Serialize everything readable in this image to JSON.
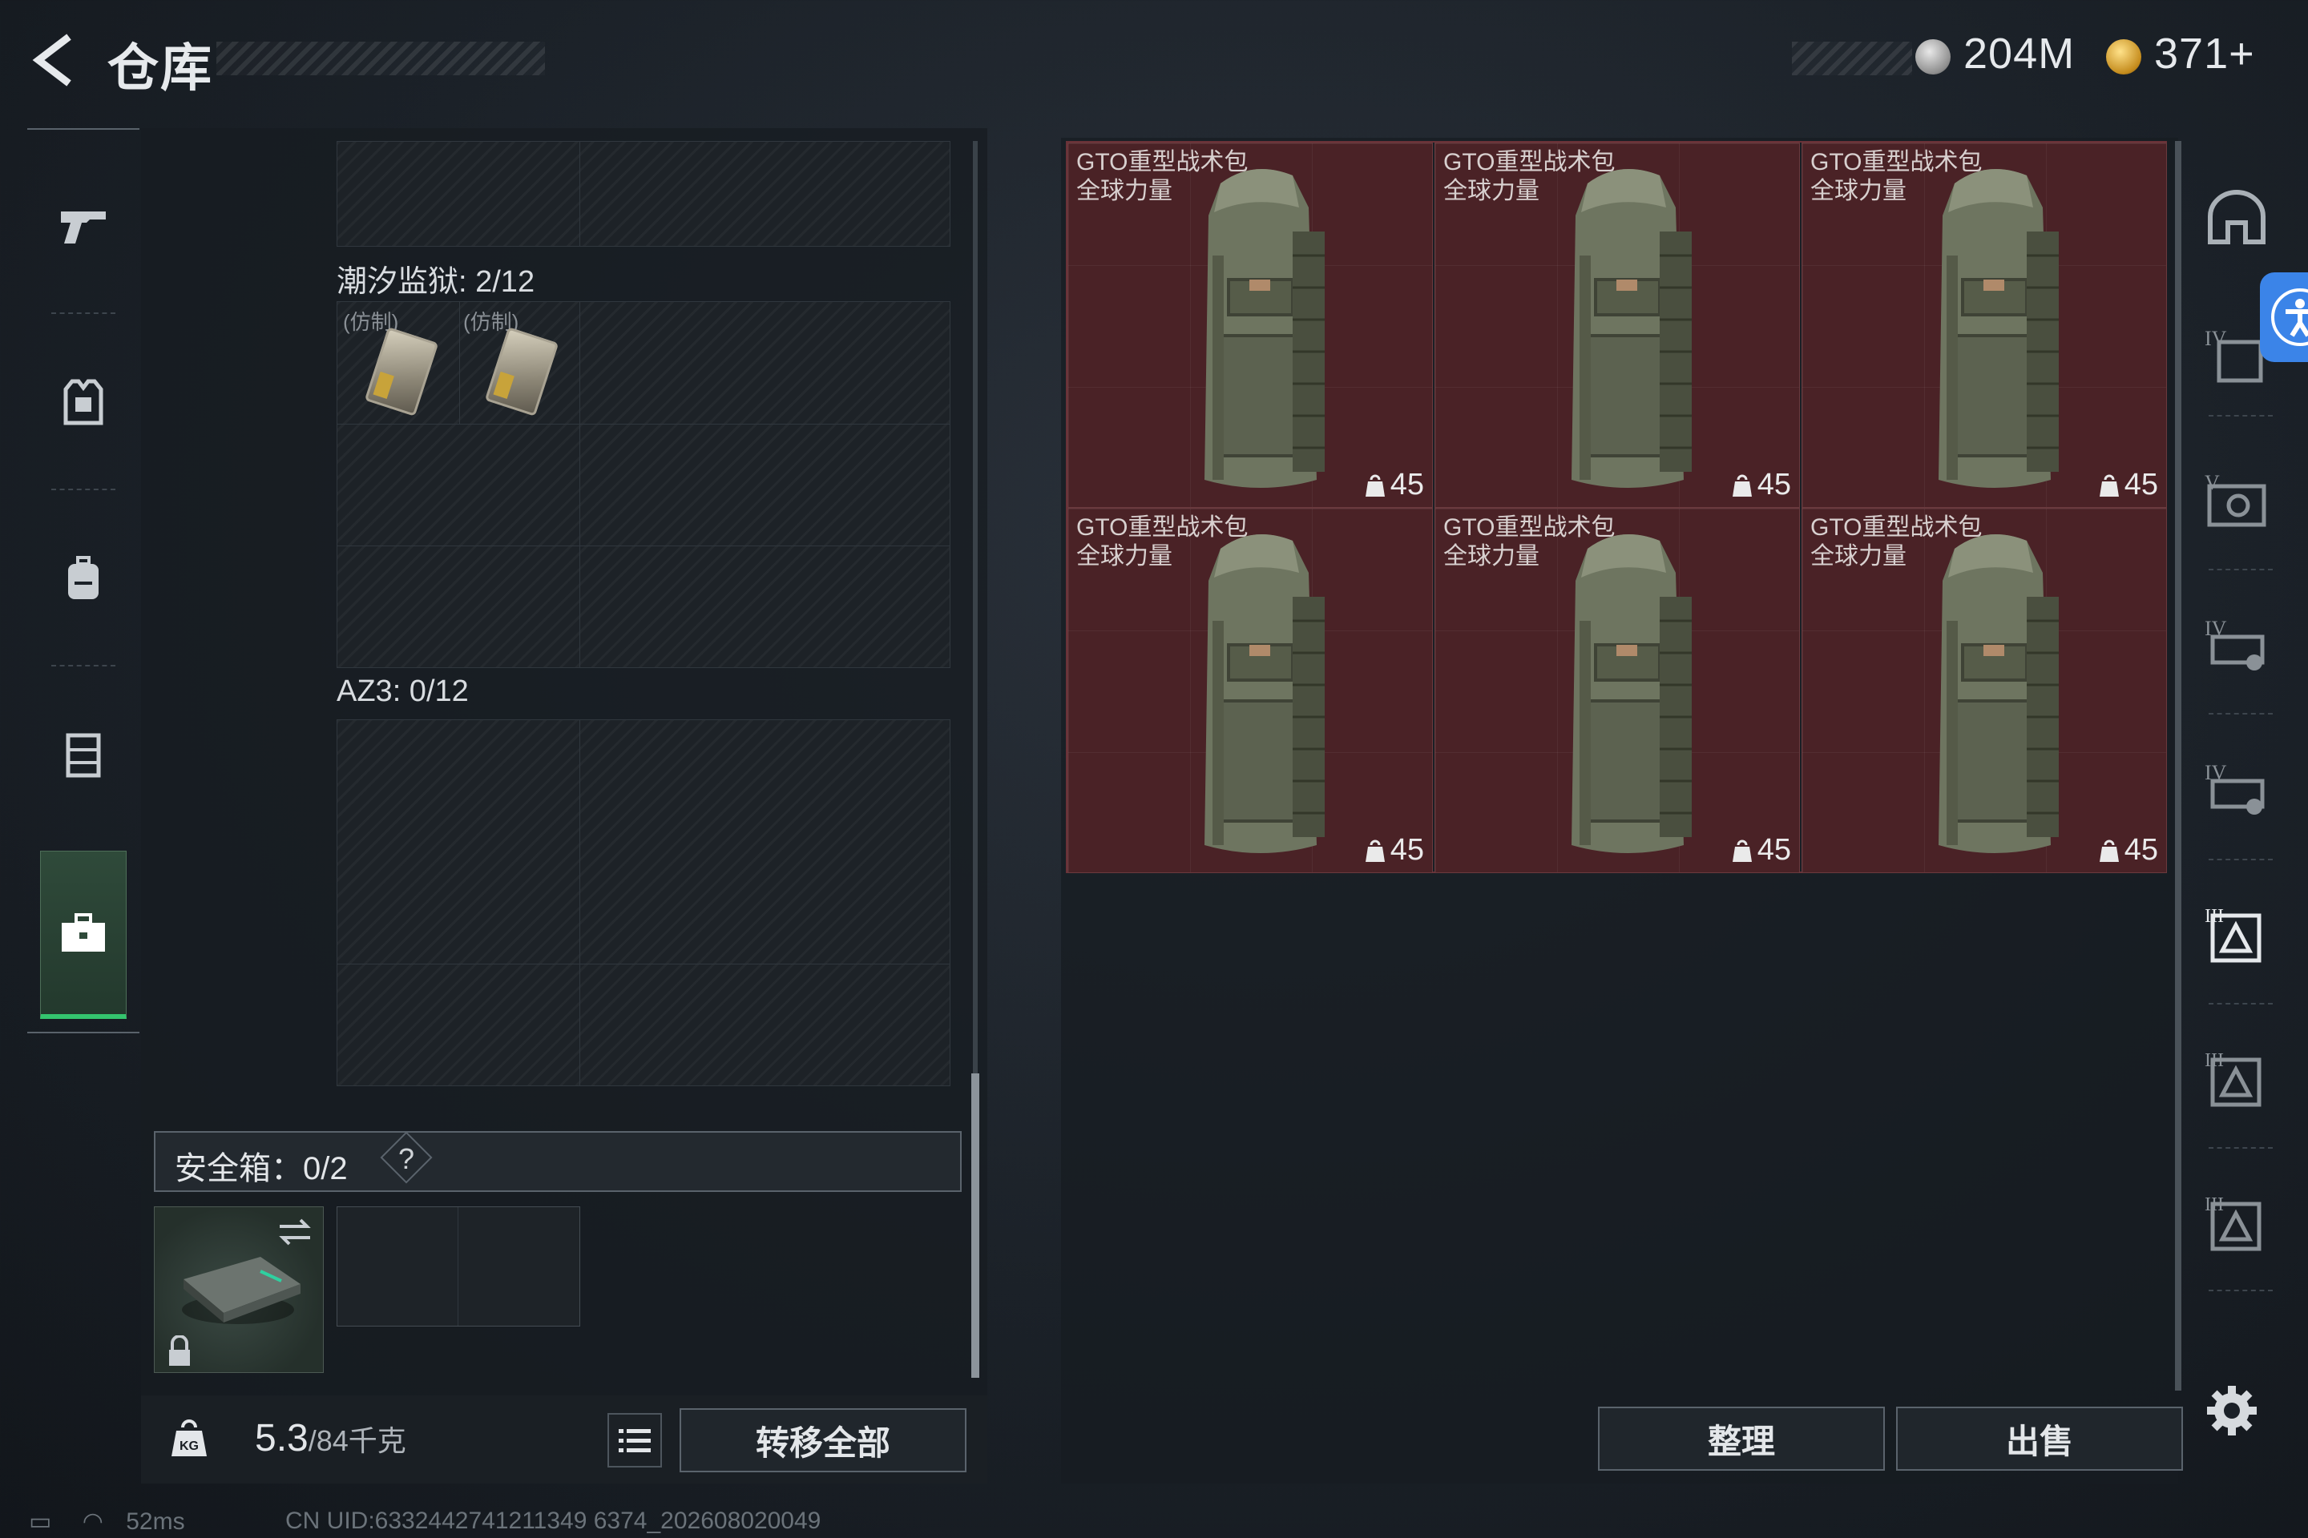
{
  "header": {
    "title": "仓库",
    "currency": [
      {
        "icon": "silver-coin-icon",
        "amount": "204M"
      },
      {
        "icon": "gold-coin-icon",
        "amount": "371+"
      }
    ]
  },
  "left_nav": {
    "items": [
      {
        "icon": "pistol-icon",
        "active": false
      },
      {
        "icon": "armor-vest-icon",
        "active": false
      },
      {
        "icon": "backpack-icon",
        "active": false
      },
      {
        "icon": "rig-icon",
        "active": false
      },
      {
        "icon": "toolbox-icon",
        "active": true
      }
    ]
  },
  "containers": {
    "tidal_prison": {
      "label": "潮汐监狱: 2/12",
      "items": [
        {
          "tag": "(仿制)"
        },
        {
          "tag": "(仿制)"
        }
      ]
    },
    "az3": {
      "label": "AZ3: 0/12"
    }
  },
  "safe": {
    "label": "安全箱：0/2",
    "help": "?"
  },
  "bottom": {
    "weight_current": "5.3",
    "weight_max": "/84千克",
    "transfer_all": "转移全部",
    "sort": "整理",
    "sell": "出售"
  },
  "stash_items": [
    {
      "line1": "GTO重型战术包",
      "line2": "全球力量",
      "weight": "45"
    },
    {
      "line1": "GTO重型战术包",
      "line2": "全球力量",
      "weight": "45"
    },
    {
      "line1": "GTO重型战术包",
      "line2": "全球力量",
      "weight": "45"
    },
    {
      "line1": "GTO重型战术包",
      "line2": "全球力量",
      "weight": "45"
    },
    {
      "line1": "GTO重型战术包",
      "line2": "全球力量",
      "weight": "45"
    },
    {
      "line1": "GTO重型战术包",
      "line2": "全球力量",
      "weight": "45"
    }
  ],
  "right_nav": {
    "items": [
      "helmet-icon",
      "armor-iv-icon",
      "armor-v-icon",
      "rig-iv-icon",
      "rig-iv-icon",
      "backpack-iii-icon",
      "backpack-iii-icon",
      "backpack-iii-icon"
    ]
  },
  "status": {
    "ping": "52ms",
    "uid": "CN UID:6332442741211349 6374_202608020049"
  },
  "colors": {
    "item_bg": "#4a2226",
    "active_green": "#34c46e",
    "accessibility": "#3b84e8"
  }
}
